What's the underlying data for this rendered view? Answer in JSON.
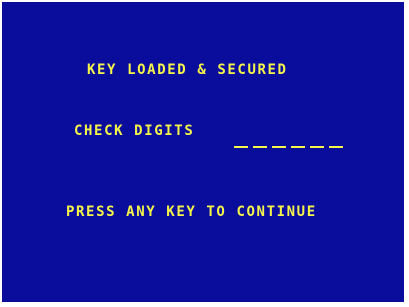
{
  "screen": {
    "title": "KEY LOADED & SECURED",
    "check_digits_label": "CHECK DIGITS",
    "check_digits_value": "",
    "check_digit_slots": 6,
    "prompt": "PRESS ANY KEY TO CONTINUE"
  },
  "colors": {
    "background": "#0a0d9c",
    "text": "#f4f44a"
  }
}
